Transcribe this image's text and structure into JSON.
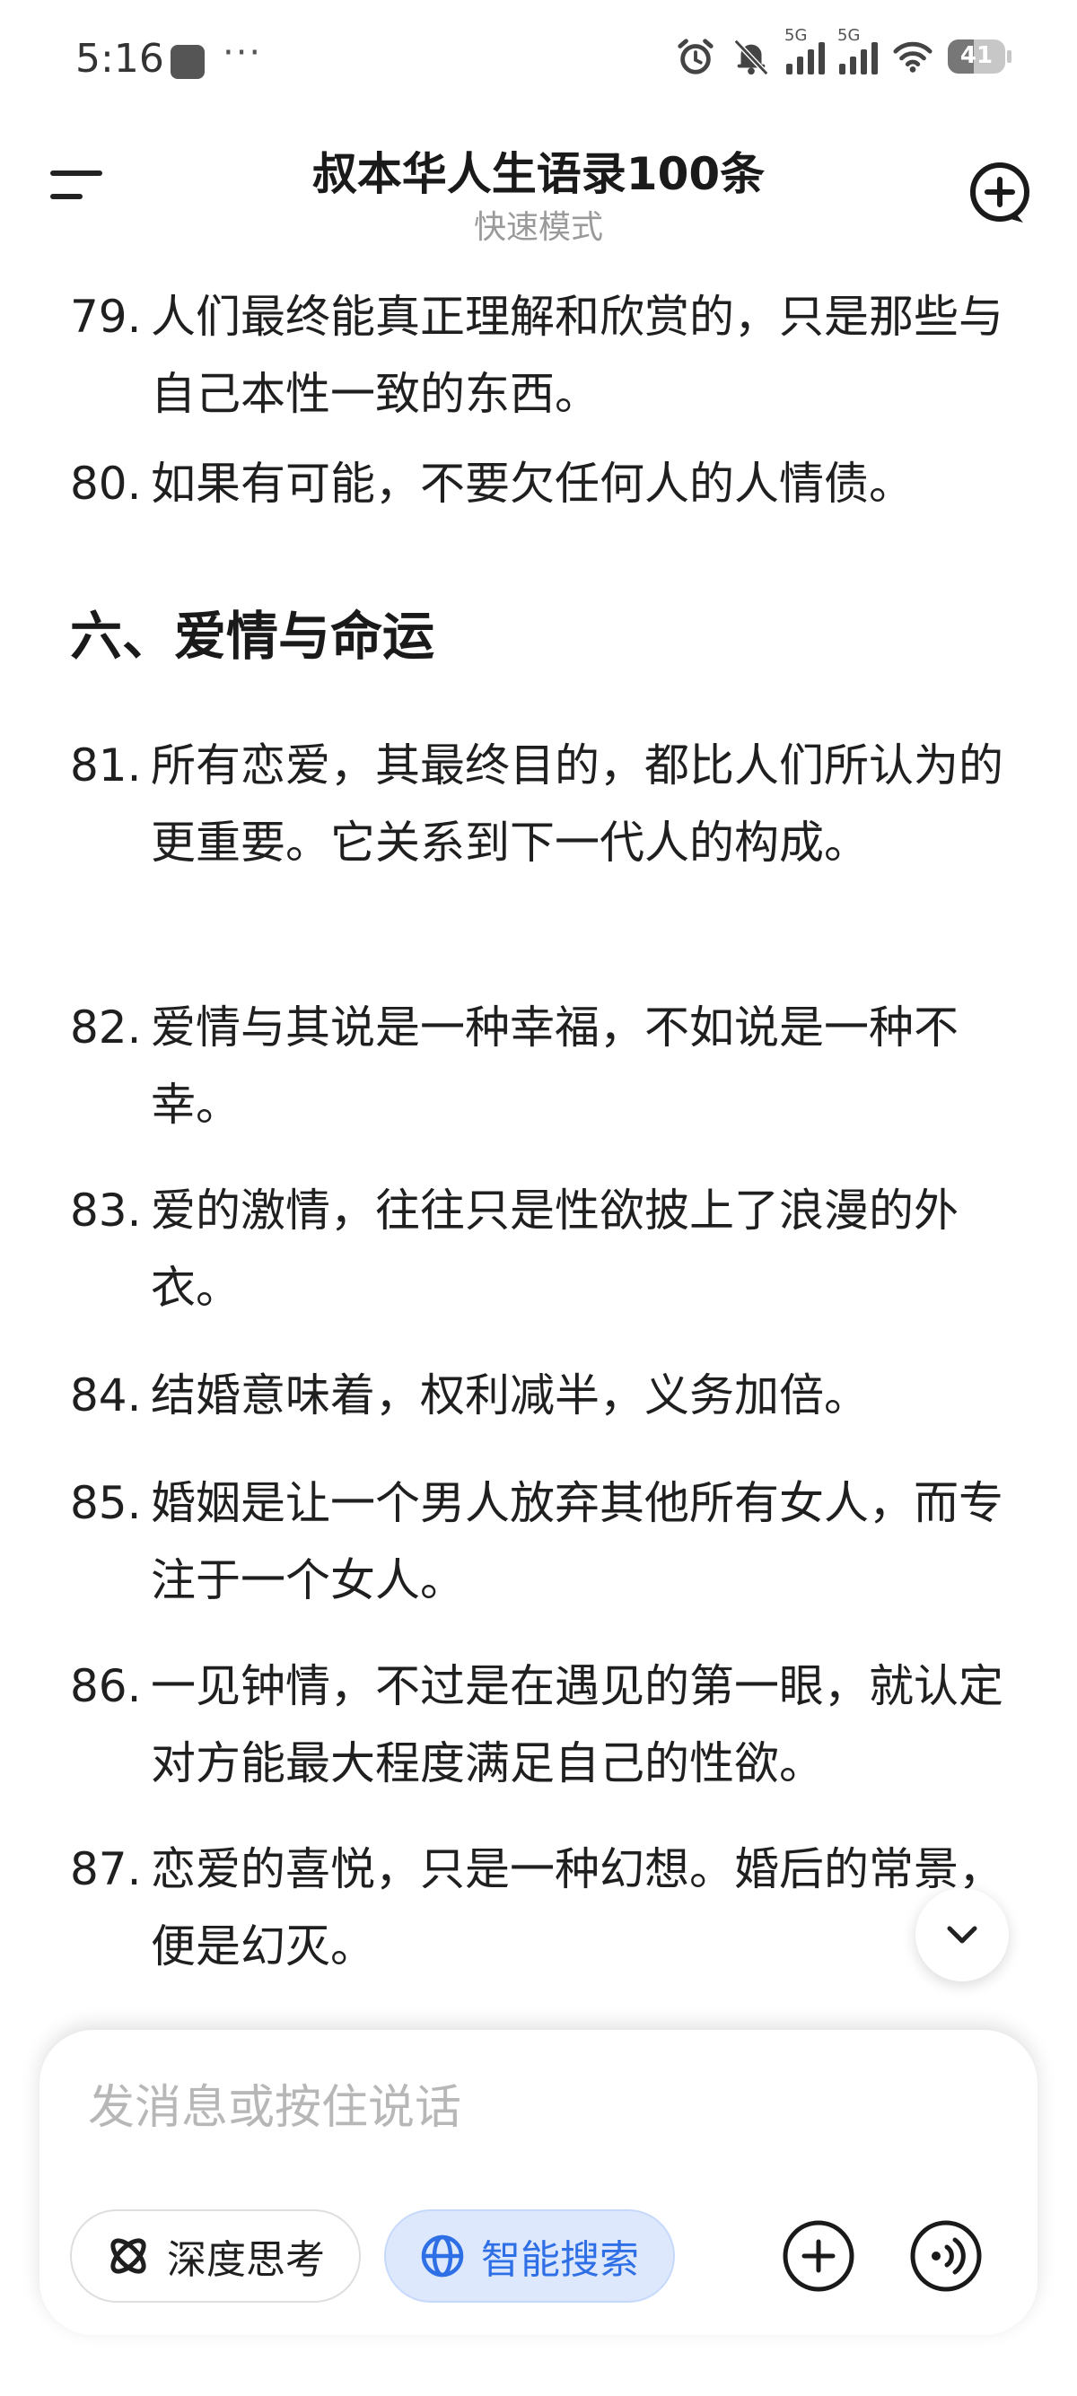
{
  "status_bar": {
    "time": "5:16",
    "more": "···",
    "signal_1_label": "5G",
    "signal_2_label": "5G",
    "battery": "41"
  },
  "header": {
    "title": "叔本华人生语录100条",
    "subtitle": "快速模式"
  },
  "content": {
    "items_before": [
      {
        "num": "79.",
        "text": "人们最终能真正理解和欣赏的，只是那些与自己本性一致的东西。"
      },
      {
        "num": "80.",
        "text": "如果有可能，不要欠任何人的人情债。"
      }
    ],
    "section_title": "六、爱情与命运",
    "items_after": [
      {
        "num": "81.",
        "text": "所有恋爱，其最终目的，都比人们所认为的更重要。它关系到下一代人的构成。"
      },
      {
        "num": "82.",
        "text": "爱情与其说是一种幸福，不如说是一种不幸。"
      },
      {
        "num": "83.",
        "text": "爱的激情，往往只是性欲披上了浪漫的外衣。"
      },
      {
        "num": "84.",
        "text": "结婚意味着，权利减半，义务加倍。"
      },
      {
        "num": "85.",
        "text": "婚姻是让一个男人放弃其他所有女人，而专注于一个女人。"
      },
      {
        "num": "86.",
        "text": "一见钟情，不过是在遇见的第一眼，就认定对方能最大程度满足自己的性欲。"
      },
      {
        "num": "87.",
        "text": "恋爱的喜悦，只是一种幻想。婚后的常景，便是幻灭。"
      }
    ]
  },
  "input": {
    "placeholder": "发消息或按住说话",
    "deep_think_label": "深度思考",
    "smart_search_label": "智能搜索"
  },
  "icons": {
    "menu": "menu-icon",
    "new_chat": "new-chat-icon",
    "scroll_down": "chevron-down-icon",
    "deep_think": "atom-icon",
    "smart_search": "globe-icon",
    "add": "plus-circle-icon",
    "voice": "voice-icon"
  },
  "colors": {
    "accent": "#2f6fe6",
    "accent_bg": "#dde8fd",
    "text": "#1f1f1f",
    "muted": "#9a9a9a"
  }
}
